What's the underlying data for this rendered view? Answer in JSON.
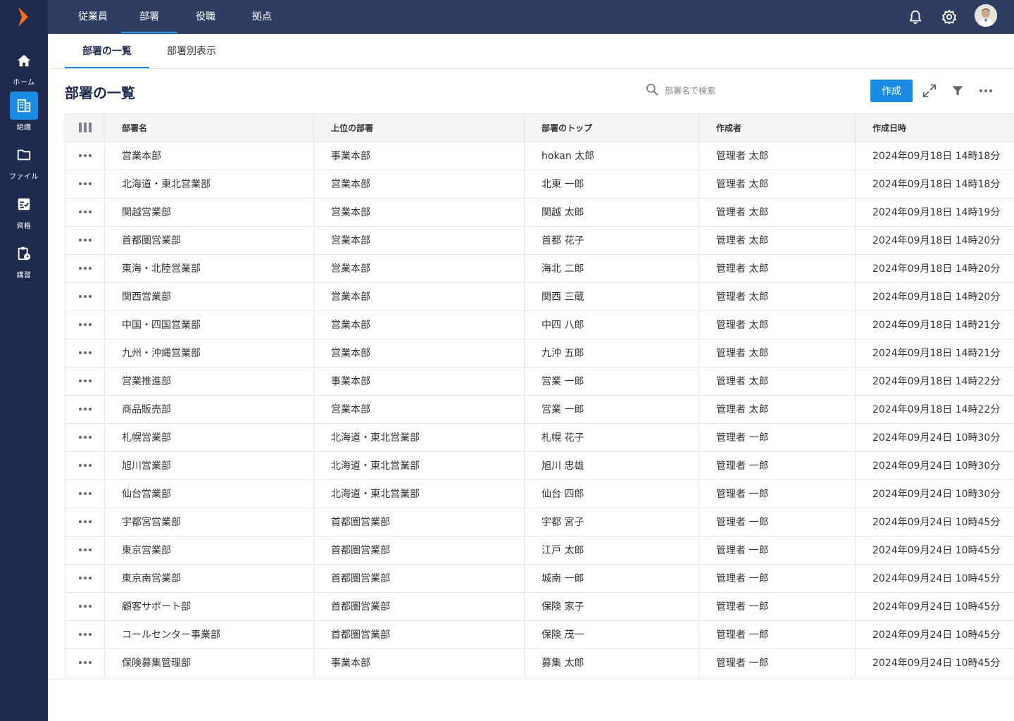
{
  "sidebar": {
    "items": [
      {
        "label": "ホーム",
        "icon": "home-icon",
        "active": false
      },
      {
        "label": "組織",
        "icon": "building-icon",
        "active": true
      },
      {
        "label": "ファイル",
        "icon": "folder-icon",
        "active": false
      },
      {
        "label": "資格",
        "icon": "checklist-icon",
        "active": false
      },
      {
        "label": "講習",
        "icon": "clipboard-clock-icon",
        "active": false
      }
    ]
  },
  "topnav": {
    "tabs": [
      {
        "label": "従業員"
      },
      {
        "label": "部署"
      },
      {
        "label": "役職"
      },
      {
        "label": "拠点"
      }
    ],
    "active": "部署"
  },
  "subtabs": {
    "tabs": [
      {
        "label": "部署の一覧"
      },
      {
        "label": "部署別表示"
      }
    ],
    "active": "部署の一覧"
  },
  "page": {
    "title": "部署の一覧",
    "search_placeholder": "部署名で検索",
    "create_label": "作成"
  },
  "colors": {
    "sidebar_bg": "#1e2a4e",
    "topbar_bg": "#2f3d63",
    "accent": "#1a8ce3"
  },
  "table": {
    "columns": [
      "部署名",
      "上位の部署",
      "部署のトップ",
      "作成者",
      "作成日時"
    ],
    "rows": [
      [
        "営業本部",
        "事業本部",
        "hokan 太郎",
        "管理者 太郎",
        "2024年09月18日 14時18分"
      ],
      [
        "北海道・東北営業部",
        "営業本部",
        "北東 一郎",
        "管理者 太郎",
        "2024年09月18日 14時18分"
      ],
      [
        "関越営業部",
        "営業本部",
        "関越 太郎",
        "管理者 太郎",
        "2024年09月18日 14時19分"
      ],
      [
        "首都圏営業部",
        "営業本部",
        "首都 花子",
        "管理者 太郎",
        "2024年09月18日 14時20分"
      ],
      [
        "東海・北陸営業部",
        "営業本部",
        "海北 二郎",
        "管理者 太郎",
        "2024年09月18日 14時20分"
      ],
      [
        "関西営業部",
        "営業本部",
        "関西 三蔵",
        "管理者 太郎",
        "2024年09月18日 14時20分"
      ],
      [
        "中国・四国営業部",
        "営業本部",
        "中四 八郎",
        "管理者 太郎",
        "2024年09月18日 14時21分"
      ],
      [
        "九州・沖縄営業部",
        "営業本部",
        "九沖 五郎",
        "管理者 太郎",
        "2024年09月18日 14時21分"
      ],
      [
        "営業推進部",
        "事業本部",
        "営業 一郎",
        "管理者 太郎",
        "2024年09月18日 14時22分"
      ],
      [
        "商品販売部",
        "営業本部",
        "営業 一郎",
        "管理者 太郎",
        "2024年09月18日 14時22分"
      ],
      [
        "札幌営業部",
        "北海道・東北営業部",
        "札幌 花子",
        "管理者 一郎",
        "2024年09月24日 10時30分"
      ],
      [
        "旭川営業部",
        "北海道・東北営業部",
        "旭川 忠雄",
        "管理者 一郎",
        "2024年09月24日 10時30分"
      ],
      [
        "仙台営業部",
        "北海道・東北営業部",
        "仙台 四郎",
        "管理者 一郎",
        "2024年09月24日 10時30分"
      ],
      [
        "宇都宮営業部",
        "首都圏営業部",
        "宇都 宮子",
        "管理者 一郎",
        "2024年09月24日 10時45分"
      ],
      [
        "東京営業部",
        "首都圏営業部",
        "江戸 太郎",
        "管理者 一郎",
        "2024年09月24日 10時45分"
      ],
      [
        "東京南営業部",
        "首都圏営業部",
        "城南 一郎",
        "管理者 一郎",
        "2024年09月24日 10時45分"
      ],
      [
        "顧客サポート部",
        "首都圏営業部",
        "保険 家子",
        "管理者 一郎",
        "2024年09月24日 10時45分"
      ],
      [
        "コールセンター事業部",
        "首都圏営業部",
        "保険 茂一",
        "管理者 一郎",
        "2024年09月24日 10時45分"
      ],
      [
        "保険募集管理部",
        "事業本部",
        "募集 太郎",
        "管理者 一郎",
        "2024年09月24日 10時45分"
      ]
    ]
  }
}
